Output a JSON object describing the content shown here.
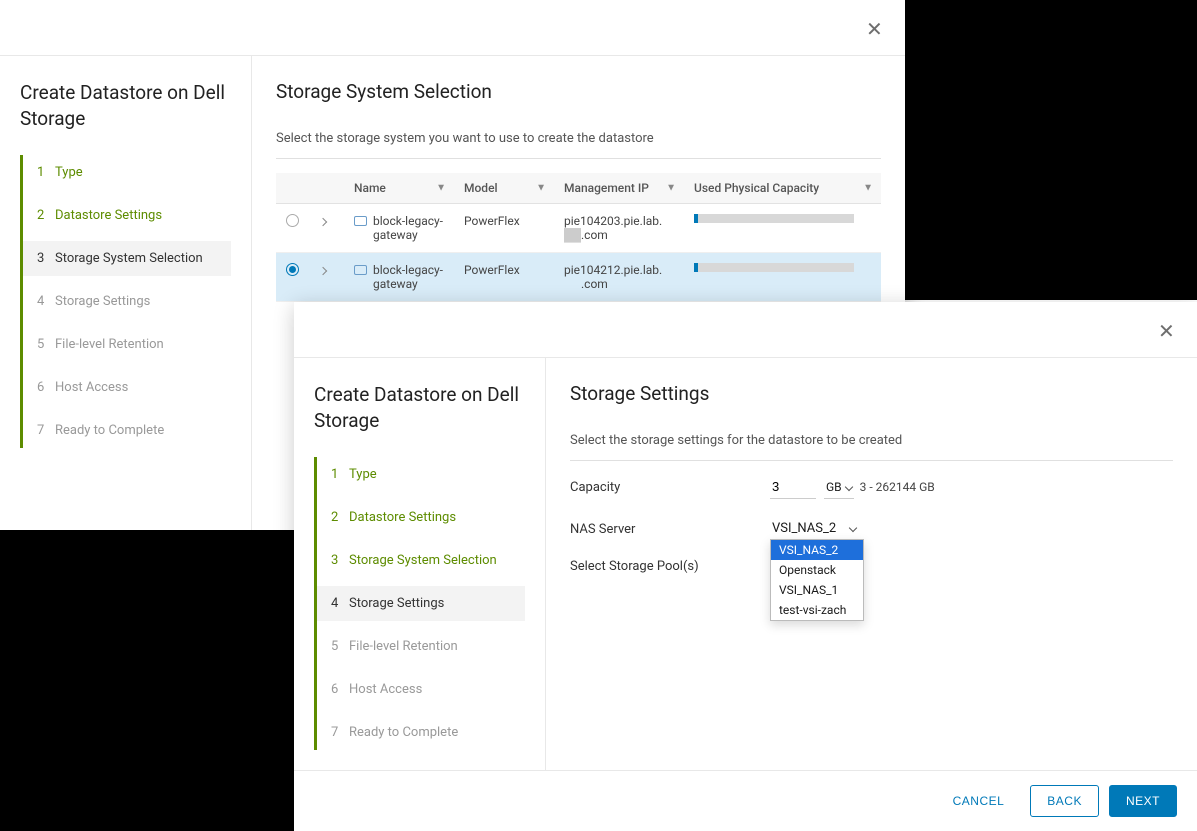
{
  "modal1": {
    "sidebar_title": "Create Datastore on Dell Storage",
    "steps": [
      {
        "num": "1",
        "label": "Type"
      },
      {
        "num": "2",
        "label": "Datastore Settings"
      },
      {
        "num": "3",
        "label": "Storage System Selection"
      },
      {
        "num": "4",
        "label": "Storage Settings"
      },
      {
        "num": "5",
        "label": "File-level Retention"
      },
      {
        "num": "6",
        "label": "Host Access"
      },
      {
        "num": "7",
        "label": "Ready to Complete"
      }
    ],
    "content_title": "Storage System Selection",
    "content_subtitle": "Select the storage system you want to use to create the datastore",
    "cols": {
      "name": "Name",
      "model": "Model",
      "mgmt_ip": "Management IP",
      "capacity": "Used Physical Capacity"
    },
    "rows": [
      {
        "name": "block-legacy-gateway",
        "model": "PowerFlex",
        "ip_line1": "pie104203.pie.lab.",
        "ip_line2": ".com"
      },
      {
        "name": "block-legacy-gateway",
        "model": "PowerFlex",
        "ip_line1": "pie104212.pie.lab.",
        "ip_line2": ".com"
      }
    ]
  },
  "modal2": {
    "sidebar_title": "Create Datastore on Dell Storage",
    "steps": [
      {
        "num": "1",
        "label": "Type"
      },
      {
        "num": "2",
        "label": "Datastore Settings"
      },
      {
        "num": "3",
        "label": "Storage System Selection"
      },
      {
        "num": "4",
        "label": "Storage Settings"
      },
      {
        "num": "5",
        "label": "File-level Retention"
      },
      {
        "num": "6",
        "label": "Host Access"
      },
      {
        "num": "7",
        "label": "Ready to Complete"
      }
    ],
    "content_title": "Storage Settings",
    "content_subtitle": "Select the storage settings for the datastore to be created",
    "capacity_label": "Capacity",
    "capacity_value": "3",
    "capacity_unit": "GB",
    "capacity_hint": "3 - 262144 GB",
    "nas_label": "NAS Server",
    "nas_value": "VSI_NAS_2",
    "nas_options": [
      "VSI_NAS_2",
      "Openstack",
      "VSI_NAS_1",
      "test-vsi-zach"
    ],
    "pool_label": "Select Storage Pool(s)",
    "buttons": {
      "cancel": "CANCEL",
      "back": "BACK",
      "next": "NEXT"
    }
  }
}
